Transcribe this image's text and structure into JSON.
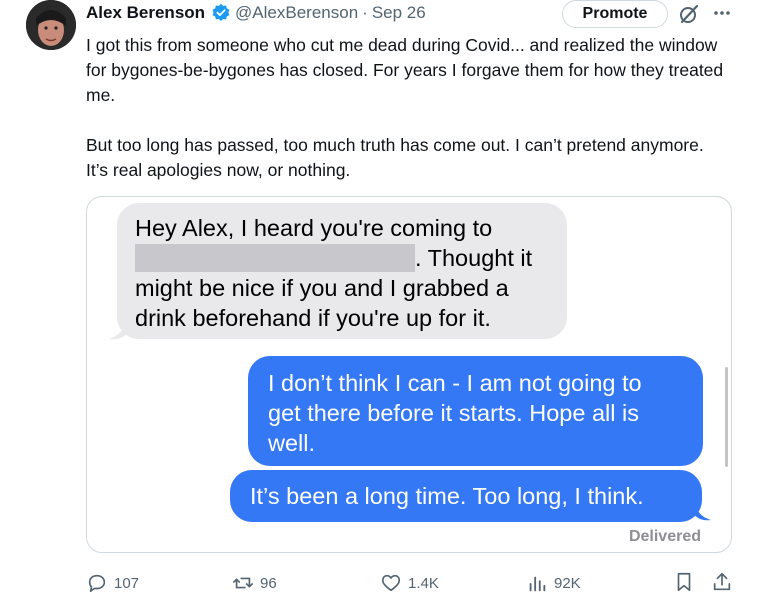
{
  "tweet": {
    "author_name": "Alex Berenson",
    "handle": "@AlexBerenson",
    "separator": "·",
    "date": "Sep 26",
    "promote_label": "Promote",
    "paragraph_1": "I got this from someone who cut me dead during Covid... and realized the window for bygones-be-bygones has closed. For years I forgave them for how they treated me.",
    "paragraph_2": "But too long has passed, too much truth has come out. I can’t pretend anymore. It’s real apologies now, or nothing."
  },
  "screenshot_messages": {
    "incoming_line_1": "Hey Alex, I heard you're coming to",
    "incoming_line_2_suffix": ". Thought it",
    "incoming_line_3": "might be nice if you and I grabbed a",
    "incoming_line_4": "drink beforehand if you're up for it.",
    "outgoing_1_line_1": "I don’t think I can - I am not going to",
    "outgoing_1_line_2": "get there before it starts. Hope all is",
    "outgoing_1_line_3": "well.",
    "outgoing_2": "It’s been a long time. Too long, I think.",
    "status": "Delivered"
  },
  "actions": {
    "replies": "107",
    "reposts": "96",
    "likes": "1.4K",
    "views": "92K"
  },
  "colors": {
    "verified": "#1d9bf0",
    "imessage_blue": "#3478f6",
    "imessage_gray": "#e9e9eb",
    "secondary_text": "#536471"
  },
  "icons": [
    "verified-badge-icon",
    "grok-icon",
    "more-icon",
    "reply-icon",
    "repost-icon",
    "like-icon",
    "views-icon",
    "bookmark-icon",
    "share-icon"
  ]
}
